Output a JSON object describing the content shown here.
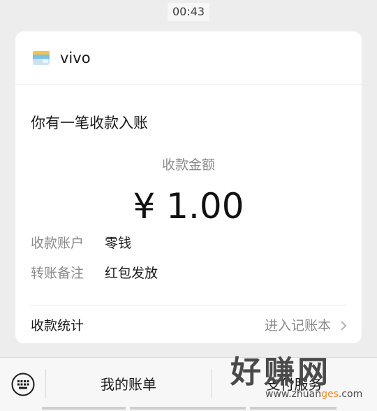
{
  "time": "00:43",
  "app": {
    "name": "vivo",
    "icon": "wallet-icon"
  },
  "notice": {
    "title": "你有一笔收款入账"
  },
  "amount": {
    "label": "收款金额",
    "value": "¥ 1.00"
  },
  "rows": [
    {
      "label": "收款账户",
      "value": "零钱"
    },
    {
      "label": "转账备注",
      "value": "红包发放"
    }
  ],
  "stats": {
    "label": "收款统计",
    "link": "进入记账本",
    "chevron_icon": "chevron-right-icon"
  },
  "bottom_bar": {
    "keyboard_icon": "keyboard-icon",
    "menu": [
      {
        "label": "我的账单"
      },
      {
        "label": "支付服务"
      }
    ]
  },
  "watermark": {
    "big": "好赚网",
    "small_prefix": "www.zhuan",
    "small_accent": "ges",
    "small_suffix": ".com",
    "accent_color": "#f08a24"
  }
}
